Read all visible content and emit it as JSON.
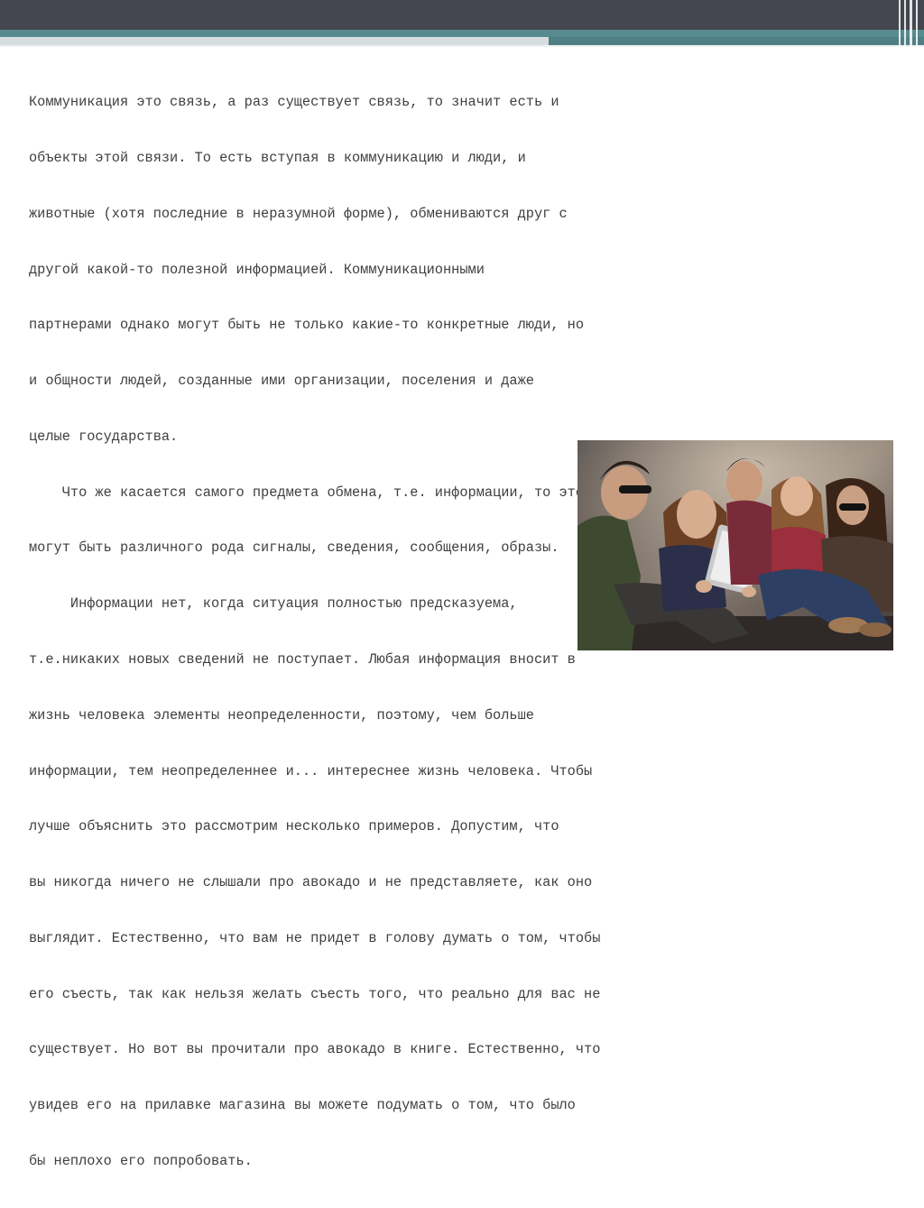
{
  "colors": {
    "header_dark": "#44474f",
    "header_teal": "#578b8f",
    "header_light": "#d7dedf",
    "text": "#3f3f3f"
  },
  "text": {
    "lines": [
      "Коммуникация это связь, а раз существует связь, то значит есть и",
      "объекты этой связи. То есть вступая в коммуникацию и люди, и",
      "животные (хотя последние в неразумной форме), обмениваются друг с",
      "другой какой-то полезной информацией. Коммуникационными",
      "партнерами однако могут быть не только какие-то конкретные люди, но",
      "и общности людей, созданные ими организации, поселения и даже",
      "целые государства.",
      "    Что же касается самого предмета обмена, т.е. информации, то это",
      "могут быть различного рода сигналы, сведения, сообщения, образы.",
      "     Информации нет, когда ситуация полностью предсказуема,",
      "т.е.никаких новых сведений не поступает. Любая информация вносит в",
      "жизнь человека элементы неопределенности, поэтому, чем больше",
      "информации, тем неопределеннее и... интереснее жизнь человека. Чтобы",
      "лучше объяснить это рассмотрим несколько примеров. Допустим, что",
      "вы никогда ничего не слышали про авокадо и не представляете, как оно",
      "выглядит. Естественно, что вам не придет в голову думать о том, чтобы",
      "его съесть, так как нельзя желать съесть того, что реально для вас не",
      "существует. Но вот вы прочитали про авокадо в книге. Естественно, что",
      "увидев его на прилавке магазина вы можете подумать о том, что было",
      "бы неплохо его попробовать."
    ]
  },
  "image": {
    "icon": "photo-group-of-young-people-with-tablet"
  }
}
